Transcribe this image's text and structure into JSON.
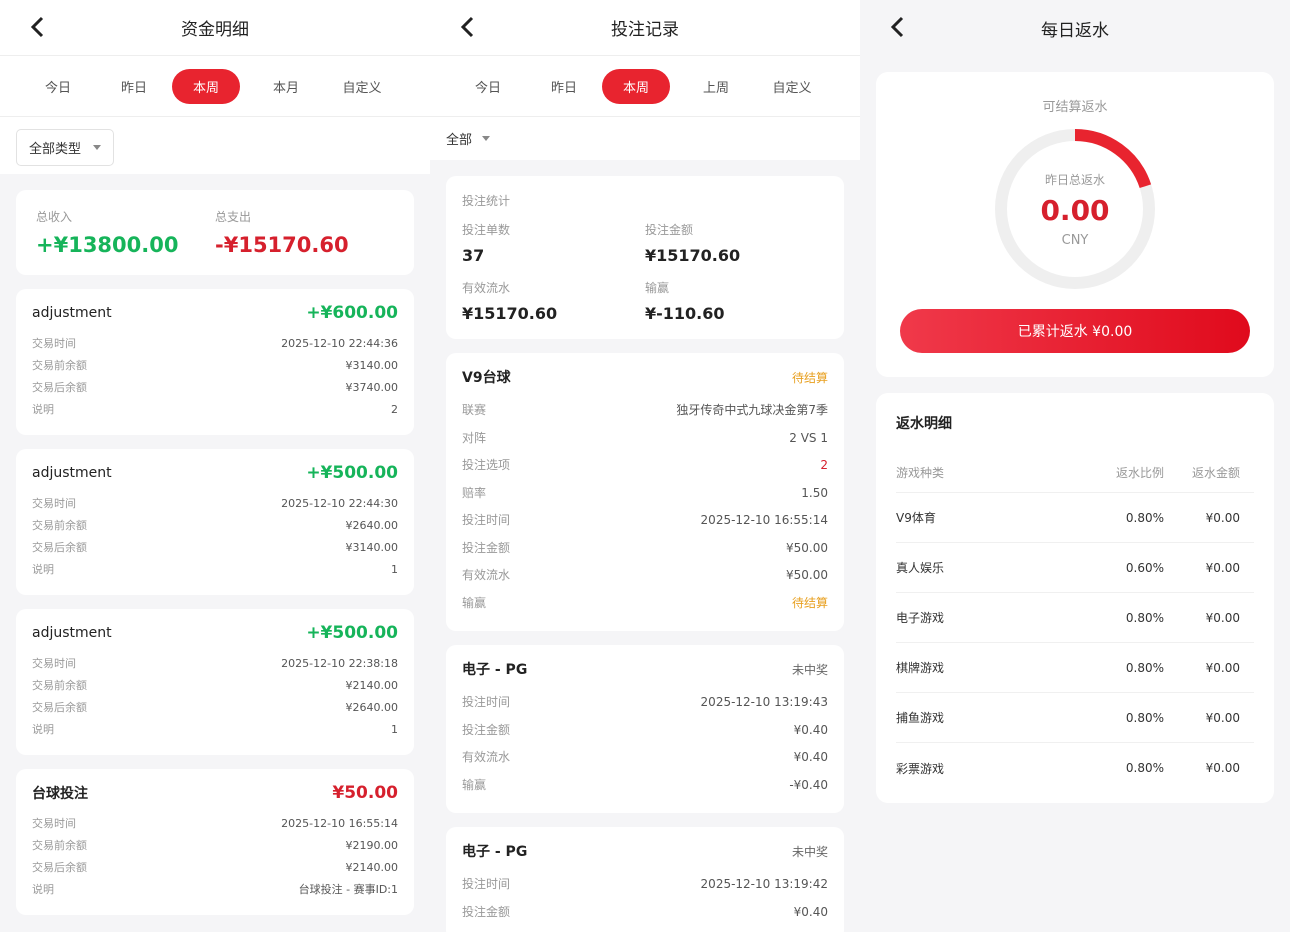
{
  "screen1": {
    "title": "资金明细",
    "tabs": [
      "今日",
      "昨日",
      "本周",
      "本月",
      "自定义"
    ],
    "filter": "全部类型",
    "summary": {
      "income_label": "总收入",
      "income_value": "+¥13800.00",
      "expense_label": "总支出",
      "expense_value": "-¥15170.60"
    },
    "records": [
      {
        "name": "adjustment",
        "amount": "+¥600.00",
        "time": "2025-12-10 22:44:36",
        "before": "¥3140.00",
        "after": "¥3740.00",
        "note": "2"
      },
      {
        "name": "adjustment",
        "amount": "+¥500.00",
        "time": "2025-12-10 22:44:30",
        "before": "¥2640.00",
        "after": "¥3140.00",
        "note": "1"
      },
      {
        "name": "adjustment",
        "amount": "+¥500.00",
        "time": "2025-12-10 22:38:18",
        "before": "¥2140.00",
        "after": "¥2640.00",
        "note": "1"
      },
      {
        "name": "台球投注",
        "amount": "¥50.00",
        "time": "2025-12-10 16:55:14",
        "before": "¥2190.00",
        "after": "¥2140.00",
        "note": "台球投注 - 赛事ID:1"
      }
    ],
    "labels": {
      "time": "交易时间",
      "before": "交易前余额",
      "after": "交易后余额",
      "note": "说明"
    }
  },
  "screen2": {
    "title": "投注记录",
    "tabs": [
      "今日",
      "昨日",
      "本周",
      "上周",
      "自定义"
    ],
    "filter": "全部",
    "stats": {
      "title": "投注统计",
      "count_label": "投注单数",
      "count": "37",
      "amount_label": "投注金额",
      "amount": "¥15170.60",
      "flow_label": "有效流水",
      "flow": "¥15170.60",
      "win_label": "输赢",
      "win": "¥-110.60"
    },
    "bet1": {
      "name": "V9台球",
      "status": "待结算",
      "labels": [
        "联赛",
        "对阵",
        "投注选项",
        "赔率",
        "投注时间",
        "投注金额",
        "有效流水",
        "输赢"
      ],
      "values": [
        "独牙传奇中式九球决金第7季",
        "2 VS 1",
        "2",
        "1.50",
        "2025-12-10 16:55:14",
        "¥50.00",
        "¥50.00",
        "待结算"
      ]
    },
    "bet2": {
      "name": "电子 - PG",
      "status": "未中奖",
      "labels": [
        "投注时间",
        "投注金额",
        "有效流水",
        "输赢"
      ],
      "values": [
        "2025-12-10 13:19:43",
        "¥0.40",
        "¥0.40",
        "-¥0.40"
      ]
    },
    "bet3": {
      "name": "电子 - PG",
      "status": "未中奖",
      "labels": [
        "投注时间",
        "投注金额"
      ],
      "values": [
        "2025-12-10 13:19:42",
        "¥0.40"
      ]
    }
  },
  "screen3": {
    "title": "每日返水",
    "settle_label": "可结算返水",
    "gauge_label": "昨日总返水",
    "gauge_value": "0.00",
    "gauge_unit": "CNY",
    "gauge_fraction": 0.2,
    "button": "已累计返水 ¥0.00",
    "table_title": "返水明细",
    "headers": [
      "游戏种类",
      "返水比例",
      "返水金额"
    ],
    "rows": [
      [
        "V9体育",
        "0.80%",
        "¥0.00"
      ],
      [
        "真人娱乐",
        "0.60%",
        "¥0.00"
      ],
      [
        "电子游戏",
        "0.80%",
        "¥0.00"
      ],
      [
        "棋牌游戏",
        "0.80%",
        "¥0.00"
      ],
      [
        "捕鱼游戏",
        "0.80%",
        "¥0.00"
      ],
      [
        "彩票游戏",
        "0.80%",
        "¥0.00"
      ]
    ]
  },
  "colors": {
    "accent": "#e8242f",
    "green": "#16b45a",
    "orange": "#e8a020"
  }
}
